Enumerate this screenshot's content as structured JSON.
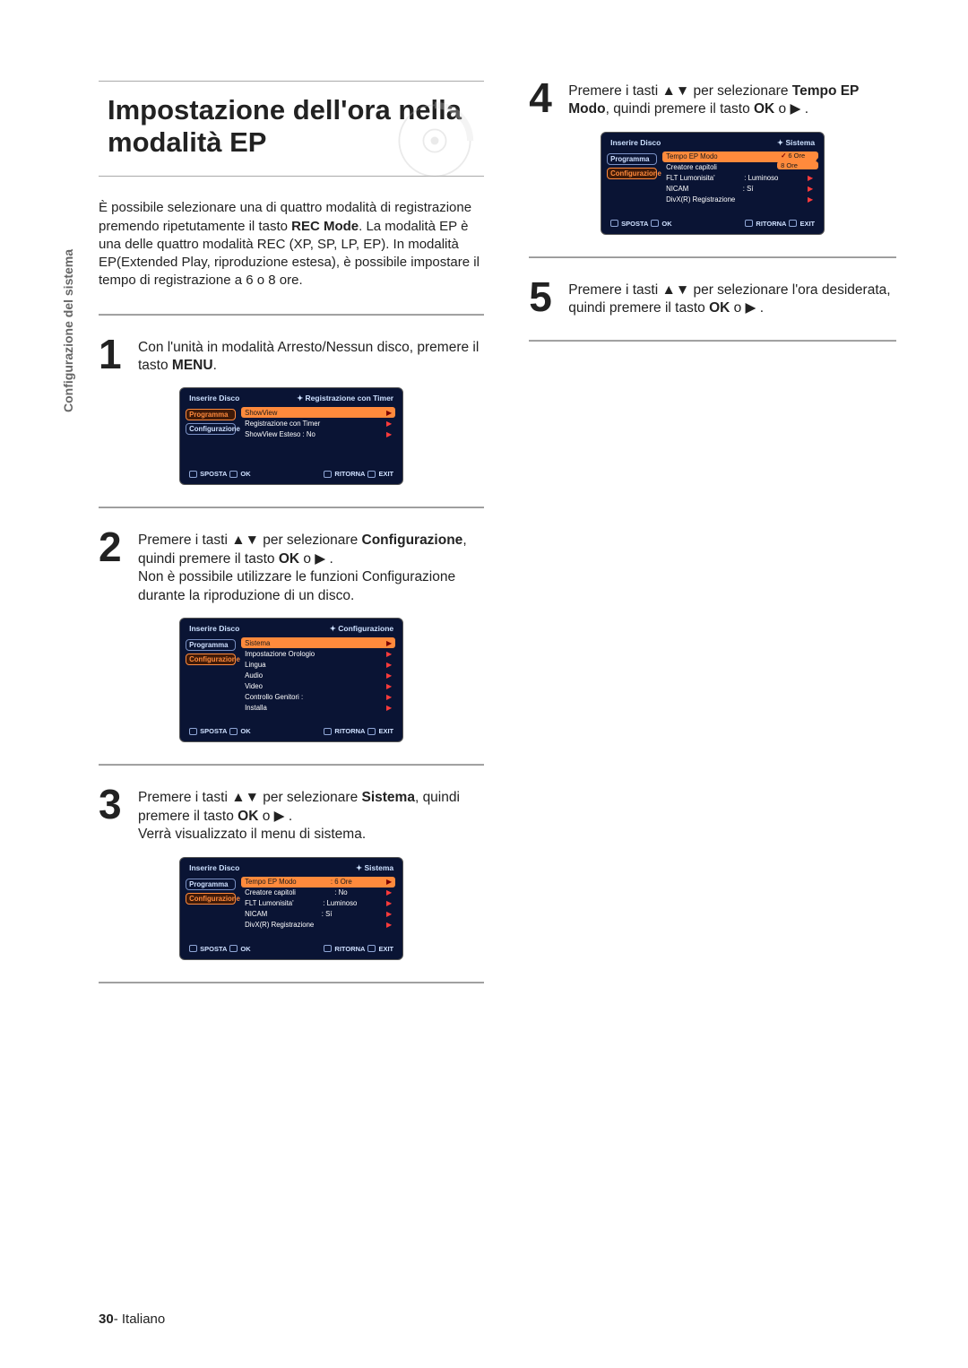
{
  "sideTab": "Configurazione del sistema",
  "title": "Impostazione dell'ora nella modalità EP",
  "intro_parts": {
    "p1": "È possibile selezionare una di quattro modalità di registrazione premendo ripetutamente il tasto ",
    "bold1": "REC Mode",
    "p2": ". La modalità EP è una delle quattro modalità REC (XP, SP, LP, EP). In modalità EP(Extended Play, riproduzione estesa), è possibile impostare il tempo di registrazione a 6 o 8 ore."
  },
  "steps": {
    "s1": {
      "num": "1",
      "a": "Con l'unità in modalità Arresto/Nessun disco, premere il tasto ",
      "b": "MENU",
      "c": "."
    },
    "s2": {
      "num": "2",
      "a": "Premere i tasti ▲▼ per selezionare ",
      "b": "Configurazione",
      "c": ", quindi premere il tasto ",
      "d": "OK",
      "e": " o ▶ .",
      "f": "Non è possibile utilizzare le funzioni Configurazione durante la riproduzione di un disco."
    },
    "s3": {
      "num": "3",
      "a": "Premere i tasti ▲▼ per selezionare ",
      "b": "Sistema",
      "c": ", quindi premere il tasto ",
      "d": "OK",
      "e": " o ▶ .",
      "f": "Verrà visualizzato il menu di sistema."
    },
    "s4": {
      "num": "4",
      "a": "Premere i tasti ▲▼ per selezionare ",
      "b": "Tempo EP Modo",
      "c": ", quindi premere il tasto ",
      "d": "OK",
      "e": " o ▶ ."
    },
    "s5": {
      "num": "5",
      "a": "Premere i tasti ▲▼ per selezionare l'ora desiderata, quindi premere il tasto ",
      "b": "OK",
      "c": " o  ▶ ."
    }
  },
  "osd": {
    "discLabel": "Inserire Disco",
    "side": {
      "prog": "Programma",
      "conf": "Configurazione"
    },
    "foot": {
      "sposta": "SPOSTA",
      "ok": "OK",
      "ritorna": "RITORNA",
      "exit": "EXIT"
    },
    "menu1": {
      "crumb": "Registrazione con Timer",
      "rows": [
        {
          "label": "ShowView",
          "val": ""
        },
        {
          "label": "Registrazione con Timer",
          "val": ""
        },
        {
          "label": "ShowView Esteso : No",
          "val": ""
        }
      ]
    },
    "menu2": {
      "crumb": "Configurazione",
      "rows": [
        {
          "label": "Sistema",
          "val": ""
        },
        {
          "label": "Impostazione Orologio",
          "val": ""
        },
        {
          "label": "Lingua",
          "val": ""
        },
        {
          "label": "Audio",
          "val": ""
        },
        {
          "label": "Video",
          "val": ""
        },
        {
          "label": "Controllo Genitori :",
          "val": ""
        },
        {
          "label": "Installa",
          "val": ""
        }
      ]
    },
    "menu3": {
      "crumb": "Sistema",
      "rows": [
        {
          "label": "Tempo EP Modo",
          "val": ": 6 Ore"
        },
        {
          "label": "Creatore capitoli",
          "val": ": No"
        },
        {
          "label": "FLT Lumonisita'",
          "val": ": Luminoso"
        },
        {
          "label": "NICAM",
          "val": ": Sí"
        },
        {
          "label": "DivX(R) Registrazione",
          "val": ""
        }
      ]
    },
    "menu4": {
      "crumb": "Sistema",
      "opts": {
        "o1": "6 Ore",
        "o2": "8 Ore"
      },
      "rows": [
        {
          "label": "Tempo EP Modo",
          "val": ""
        },
        {
          "label": "Creatore capitoli",
          "val": ""
        },
        {
          "label": "FLT Lumonisita'",
          "val": ": Luminoso"
        },
        {
          "label": "NICAM",
          "val": ": Sí"
        },
        {
          "label": "DivX(R) Registrazione",
          "val": ""
        }
      ]
    }
  },
  "footer": {
    "pageNum": "30",
    "sep": "- ",
    "lang": "Italiano"
  }
}
